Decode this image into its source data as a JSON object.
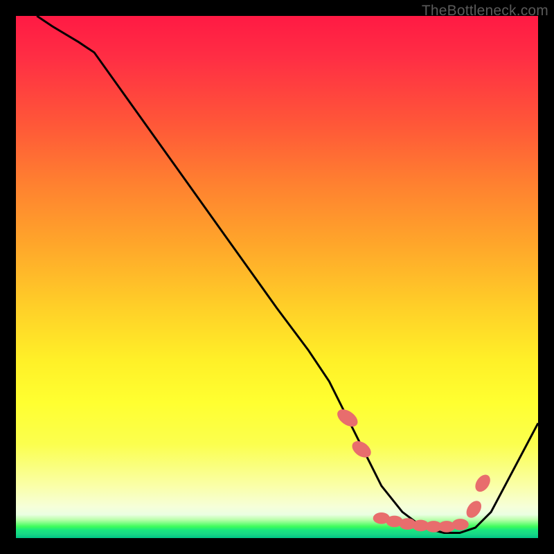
{
  "watermark": "TheBottleneck.com",
  "chart_data": {
    "type": "line",
    "title": "",
    "xlabel": "",
    "ylabel": "",
    "xlim": [
      0,
      100
    ],
    "ylim": [
      0,
      100
    ],
    "series": [
      {
        "name": "curve",
        "x": [
          4,
          7,
          12,
          15,
          20,
          30,
          40,
          50,
          56,
          60,
          63,
          66,
          70,
          74,
          78,
          82,
          85,
          88,
          91,
          100
        ],
        "y": [
          100,
          98,
          95,
          93,
          86,
          72,
          58,
          44,
          36,
          30,
          24,
          18,
          10,
          5,
          2,
          1,
          1,
          2,
          5,
          22
        ]
      }
    ],
    "markers": {
      "name": "highlighted-points",
      "points": [
        {
          "x": 63.5,
          "y": 23,
          "shape": "ellipse",
          "rx": 1.3,
          "ry": 2.2,
          "angle": -55
        },
        {
          "x": 66.2,
          "y": 17,
          "shape": "ellipse",
          "rx": 1.3,
          "ry": 2.0,
          "angle": -55
        },
        {
          "x": 70,
          "y": 3.8,
          "shape": "ellipse",
          "rx": 1.6,
          "ry": 1.1,
          "angle": 0
        },
        {
          "x": 72.5,
          "y": 3.2,
          "shape": "ellipse",
          "rx": 1.6,
          "ry": 1.1,
          "angle": 0
        },
        {
          "x": 75,
          "y": 2.7,
          "shape": "ellipse",
          "rx": 1.6,
          "ry": 1.1,
          "angle": 0
        },
        {
          "x": 77.5,
          "y": 2.4,
          "shape": "ellipse",
          "rx": 1.6,
          "ry": 1.1,
          "angle": 0
        },
        {
          "x": 80,
          "y": 2.2,
          "shape": "ellipse",
          "rx": 1.6,
          "ry": 1.1,
          "angle": 0
        },
        {
          "x": 82.5,
          "y": 2.2,
          "shape": "ellipse",
          "rx": 1.6,
          "ry": 1.1,
          "angle": 0
        },
        {
          "x": 85.1,
          "y": 2.6,
          "shape": "ellipse",
          "rx": 1.6,
          "ry": 1.1,
          "angle": 0
        },
        {
          "x": 87.7,
          "y": 5.5,
          "shape": "ellipse",
          "rx": 1.2,
          "ry": 1.8,
          "angle": 35
        },
        {
          "x": 89.4,
          "y": 10.5,
          "shape": "ellipse",
          "rx": 1.2,
          "ry": 1.8,
          "angle": 35
        }
      ]
    }
  }
}
